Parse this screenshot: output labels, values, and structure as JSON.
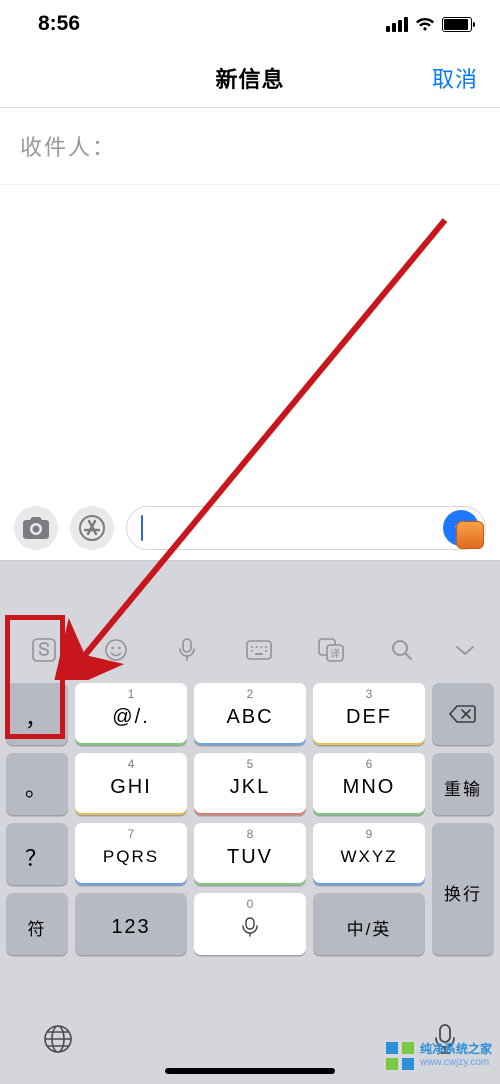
{
  "status": {
    "time": "8:56"
  },
  "nav": {
    "title": "新信息",
    "cancel": "取消"
  },
  "recipient": {
    "label": "收件人："
  },
  "compose": {
    "input_value": ""
  },
  "toolbar_icons": {
    "logo": "sogou-s-icon",
    "emoji": "emoji-icon",
    "voice": "mic-icon",
    "keyboard": "keyboard-icon",
    "translate": "translate-icon",
    "search": "search-icon",
    "collapse": "chevron-down-icon"
  },
  "keys": {
    "side": {
      "comma": "，",
      "period": "。",
      "question": "？",
      "symbol": "符"
    },
    "row1": [
      {
        "num": "1",
        "label": "@/."
      },
      {
        "num": "2",
        "label": "ABC"
      },
      {
        "num": "3",
        "label": "DEF"
      }
    ],
    "row2": [
      {
        "num": "4",
        "label": "GHI"
      },
      {
        "num": "5",
        "label": "JKL"
      },
      {
        "num": "6",
        "label": "MNO"
      }
    ],
    "row3": [
      {
        "num": "7",
        "label": "PQRS"
      },
      {
        "num": "8",
        "label": "TUV"
      },
      {
        "num": "9",
        "label": "WXYZ"
      }
    ],
    "row4": {
      "num": "123",
      "zero": "0",
      "lang": "中/英"
    },
    "right": {
      "retype": "重输",
      "enter": "换行"
    },
    "backspace": "⌫"
  },
  "watermark": {
    "line1": "纯净系统之家",
    "line2": "www.cwjzy.com"
  }
}
